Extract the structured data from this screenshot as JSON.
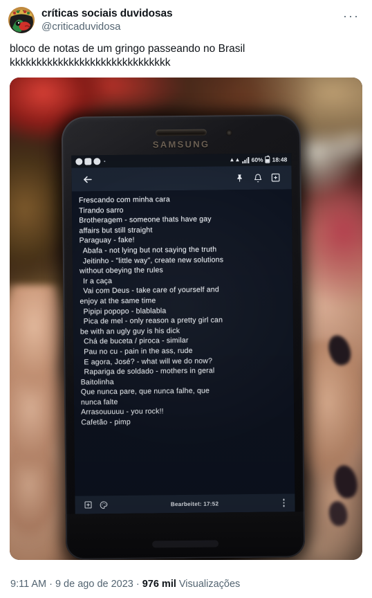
{
  "header": {
    "display_name": "críticas sociais duvidosas",
    "handle": "@criticaduvidosa",
    "more_menu": "···",
    "avatar_icon": "cartoon-avatar"
  },
  "tweet": {
    "text_line1": "bloco de notas de um gringo passeando no Brasil",
    "text_line2": "kkkkkkkkkkkkkkkkkkkkkkkkkkkkkk"
  },
  "photo": {
    "alt": "photo of a hand holding a Samsung phone showing a notes app",
    "phone": {
      "brand": "SAMSUNG",
      "statusbar": {
        "app_icons": [
          "whatsapp-icon",
          "instagram-icon",
          "app-icon"
        ],
        "wifi": "signal-icon",
        "battery_pct": "60%",
        "clock": "18:48"
      },
      "appbar": {
        "back_icon": "back-arrow-icon",
        "pin_icon": "pin-icon",
        "reminder_icon": "bell-icon",
        "add_image_icon": "add-image-icon"
      },
      "note_lines": [
        {
          "text": "Frescando com minha cara",
          "indent": false
        },
        {
          "text": "Tirando sarro",
          "indent": false
        },
        {
          "text": "Brotheragem - someone thats have gay",
          "indent": false
        },
        {
          "text": "affairs but still straight",
          "indent": false
        },
        {
          "text": "Paraguay - fake!",
          "indent": false
        },
        {
          "text": "Abafa - not lying but not saying the truth",
          "indent": true
        },
        {
          "text": "Jeitinho - \"little way\", create new solutions",
          "indent": true
        },
        {
          "text": "without obeying the rules",
          "indent": false
        },
        {
          "text": "Ir a caça",
          "indent": true
        },
        {
          "text": "Vai com Deus - take care of yourself and",
          "indent": true
        },
        {
          "text": "enjoy at the same time",
          "indent": false
        },
        {
          "text": "Pipipi popopo - blablabla",
          "indent": true
        },
        {
          "text": "Pica de mel - only reason a pretty girl can",
          "indent": true
        },
        {
          "text": "be with an ugly guy is his dick",
          "indent": false
        },
        {
          "text": "Chá de buceta / piroca - similar",
          "indent": true
        },
        {
          "text": "Pau no cu - pain in the ass, rude",
          "indent": true
        },
        {
          "text": "E agora, José? - what will we do now?",
          "indent": true
        },
        {
          "text": "Rapariga de soldado - mothers in geral",
          "indent": true
        },
        {
          "text": "Baitolinha",
          "indent": false
        },
        {
          "text": "Que nunca pare, que nunca falhe, que",
          "indent": false
        },
        {
          "text": "nunca falte",
          "indent": false
        },
        {
          "text": "Arrasouuuuu - you rock!!",
          "indent": false
        },
        {
          "text": "Cafetão - pimp",
          "indent": false
        }
      ],
      "bottombar": {
        "add_icon": "add-box-icon",
        "palette_icon": "palette-icon",
        "edited_label": "Bearbeitet: 17:52",
        "overflow_icon": "kebab-menu-icon"
      }
    }
  },
  "footer": {
    "time": "9:11 AM",
    "separator": "·",
    "date": "9 de ago de 2023",
    "views_count": "976 mil",
    "views_label": "Visualizações"
  },
  "colors": {
    "text_primary": "#0f1419",
    "text_secondary": "#536471",
    "note_bg": "#0d1320",
    "note_text": "#eef2f7",
    "appbar_bg": "#1b2433"
  }
}
